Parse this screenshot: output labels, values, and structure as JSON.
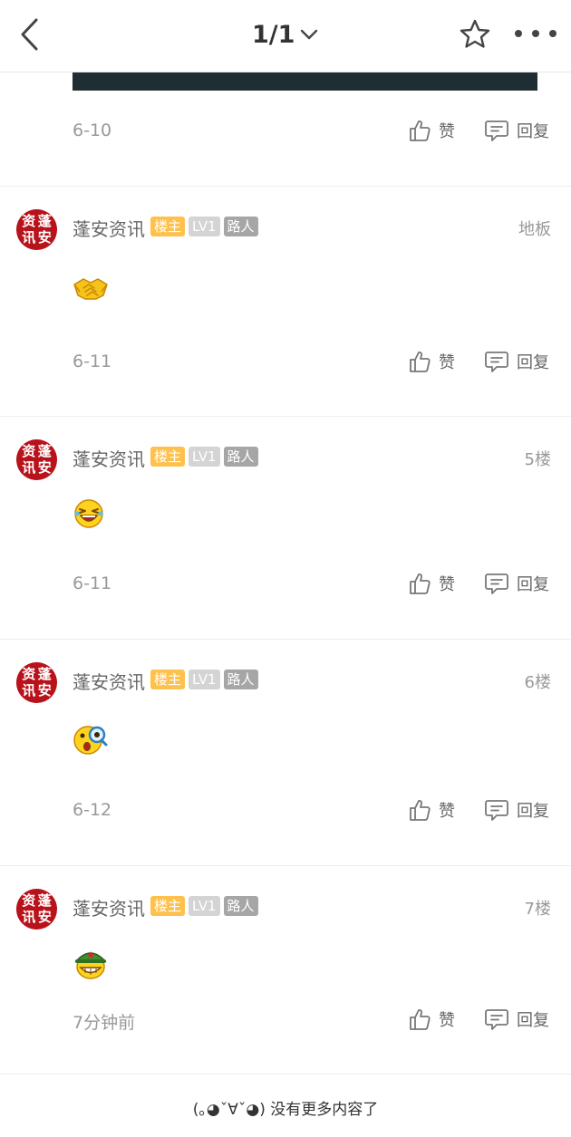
{
  "header": {
    "page_indicator": "1/1",
    "back_icon": "chevron-left-icon",
    "star_icon": "star-outline-icon",
    "more_icon": "more-horizontal-icon",
    "dropdown_icon": "chevron-down-icon"
  },
  "actions": {
    "like_label": "赞",
    "reply_label": "回复"
  },
  "top_reply": {
    "date": "6-10"
  },
  "posts": [
    {
      "author": "蓬安资讯",
      "badges": [
        "楼主",
        "LV1",
        "路人"
      ],
      "floor": "地板",
      "date": "6-11",
      "emoji": "handshake-emoji",
      "avatar_text": [
        "资",
        "蓬",
        "讯",
        "安"
      ]
    },
    {
      "author": "蓬安资讯",
      "badges": [
        "楼主",
        "LV1",
        "路人"
      ],
      "floor": "5楼",
      "date": "6-11",
      "emoji": "laughing-emoji",
      "avatar_text": [
        "资",
        "蓬",
        "讯",
        "安"
      ]
    },
    {
      "author": "蓬安资讯",
      "badges": [
        "楼主",
        "LV1",
        "路人"
      ],
      "floor": "6楼",
      "date": "6-12",
      "emoji": "magnifier-surprised-emoji",
      "avatar_text": [
        "资",
        "蓬",
        "讯",
        "安"
      ]
    },
    {
      "author": "蓬安资讯",
      "badges": [
        "楼主",
        "LV1",
        "路人"
      ],
      "floor": "7楼",
      "date": "7分钟前",
      "emoji": "soldier-grin-emoji",
      "avatar_text": [
        "资",
        "蓬",
        "讯",
        "安"
      ]
    }
  ],
  "footer": {
    "no_more_text": "(｡◕ˇ∀ˇ◕) 没有更多内容了"
  },
  "colors": {
    "avatar_red": "#b8121b",
    "badge_host": "#ffc14d",
    "badge_lv": "#d4d4d4",
    "badge_role": "#a6a6a6",
    "image_strip": "#1f2e33"
  }
}
